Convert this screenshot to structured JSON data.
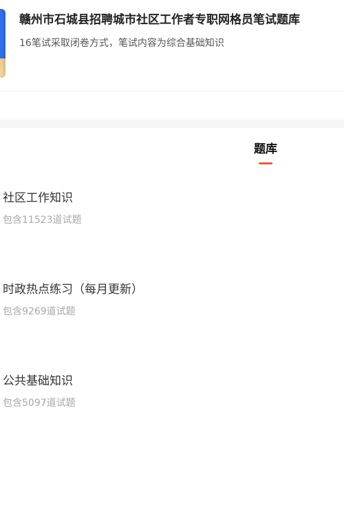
{
  "bank": {
    "title": "赣州市石城县招聘城市社区工作者专职网格员笔试题库",
    "description": "16笔试采取闭卷方式，笔试内容为综合基础知识",
    "cover_color": "#2f6ee7"
  },
  "tabs": [
    {
      "label": "题库",
      "active": true,
      "indicator_color": "#ef5a3c"
    }
  ],
  "question_sets": [
    {
      "name": "社区工作知识",
      "count_text": "包含11523道试题"
    },
    {
      "name": "时政热点练习（每月更新）",
      "count_text": "包含9269道试题"
    },
    {
      "name": "公共基础知识",
      "count_text": "包含5097道试题"
    }
  ],
  "colors": {
    "background": "#ffffff",
    "divider": "#f5f5f5",
    "title": "#222222",
    "muted_text": "#a8a8a8",
    "accent": "#ef5a3c"
  }
}
